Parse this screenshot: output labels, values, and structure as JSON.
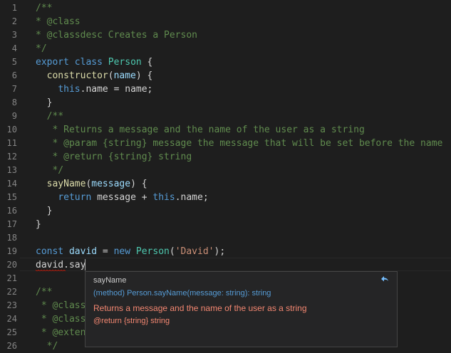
{
  "editor": {
    "line_numbers": [
      "1",
      "2",
      "3",
      "4",
      "5",
      "6",
      "7",
      "8",
      "9",
      "10",
      "11",
      "12",
      "13",
      "14",
      "15",
      "16",
      "17",
      "18",
      "19",
      "20",
      "21",
      "22",
      "23",
      "24",
      "25",
      "26"
    ],
    "lines": [
      [
        {
          "t": "/**",
          "c": "comment"
        }
      ],
      [
        {
          "t": "* @class",
          "c": "comment"
        }
      ],
      [
        {
          "t": "* @classdesc Creates a Person",
          "c": "comment"
        }
      ],
      [
        {
          "t": "*/",
          "c": "comment"
        }
      ],
      [
        {
          "t": "export ",
          "c": "keyword"
        },
        {
          "t": "class ",
          "c": "keyword"
        },
        {
          "t": "Person",
          "c": "class"
        },
        {
          "t": " {",
          "c": "plain"
        }
      ],
      [
        {
          "t": "  ",
          "c": "plain"
        },
        {
          "t": "constructor",
          "c": "func"
        },
        {
          "t": "(",
          "c": "plain"
        },
        {
          "t": "name",
          "c": "param"
        },
        {
          "t": ") {",
          "c": "plain"
        }
      ],
      [
        {
          "t": "    ",
          "c": "plain"
        },
        {
          "t": "this",
          "c": "keyword"
        },
        {
          "t": ".name = name;",
          "c": "plain"
        }
      ],
      [
        {
          "t": "  }",
          "c": "plain"
        }
      ],
      [
        {
          "t": "  /**",
          "c": "comment"
        }
      ],
      [
        {
          "t": "   * Returns a message and the name of the user as a string",
          "c": "comment"
        }
      ],
      [
        {
          "t": "   * @param {string} message the message that will be set before the name",
          "c": "comment"
        }
      ],
      [
        {
          "t": "   * @return {string} string",
          "c": "comment"
        }
      ],
      [
        {
          "t": "   */",
          "c": "comment"
        }
      ],
      [
        {
          "t": "  ",
          "c": "plain"
        },
        {
          "t": "sayName",
          "c": "func"
        },
        {
          "t": "(",
          "c": "plain"
        },
        {
          "t": "message",
          "c": "param"
        },
        {
          "t": ") {",
          "c": "plain"
        }
      ],
      [
        {
          "t": "    ",
          "c": "plain"
        },
        {
          "t": "return ",
          "c": "keyword"
        },
        {
          "t": "message + ",
          "c": "plain"
        },
        {
          "t": "this",
          "c": "keyword"
        },
        {
          "t": ".name;",
          "c": "plain"
        }
      ],
      [
        {
          "t": "  }",
          "c": "plain"
        }
      ],
      [
        {
          "t": "}",
          "c": "plain"
        }
      ],
      [],
      [
        {
          "t": "const ",
          "c": "keyword"
        },
        {
          "t": "david",
          "c": "param"
        },
        {
          "t": " = ",
          "c": "plain"
        },
        {
          "t": "new ",
          "c": "keyword"
        },
        {
          "t": "Person",
          "c": "class"
        },
        {
          "t": "(",
          "c": "plain"
        },
        {
          "t": "'David'",
          "c": "string"
        },
        {
          "t": ");",
          "c": "plain"
        }
      ],
      [
        {
          "t": "david.say",
          "c": "plain"
        }
      ],
      [],
      [
        {
          "t": "/**",
          "c": "comment"
        }
      ],
      [
        {
          "t": " * @class",
          "c": "comment"
        }
      ],
      [
        {
          "t": " * @class",
          "c": "comment"
        }
      ],
      [
        {
          "t": " * @exten",
          "c": "comment"
        }
      ],
      [
        {
          "t": "  */",
          "c": "comment"
        }
      ]
    ]
  },
  "hover": {
    "title": "sayName",
    "signature": "(method) Person.sayName(message: string): string",
    "description": "Returns a message and the name of the user as a string",
    "return_doc": "@return {string} string",
    "back_icon": "reply-arrow-icon"
  },
  "colors": {
    "background": "#1e1e1e",
    "comment": "#608b4e",
    "keyword": "#569cd6",
    "class": "#4ec9b0",
    "function": "#dcdcaa",
    "parameter": "#9cdcfe",
    "string": "#ce9178",
    "error": "#e51400"
  }
}
